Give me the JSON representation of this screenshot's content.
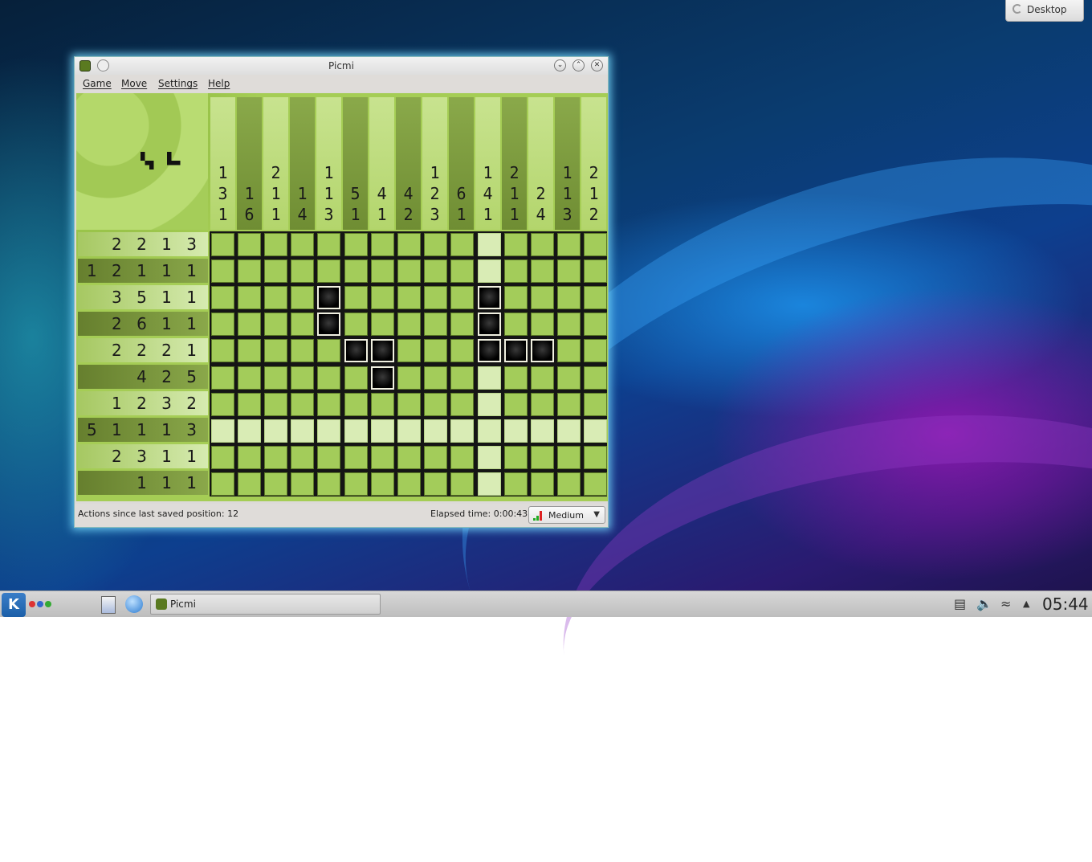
{
  "desktop_tab": {
    "label": "Desktop"
  },
  "window": {
    "title": "Picmi"
  },
  "menu": [
    "Game",
    "Move",
    "Settings",
    "Help"
  ],
  "puzzle": {
    "col_clues": [
      [
        "1",
        "3",
        "1"
      ],
      [
        "1",
        "6"
      ],
      [
        "2",
        "1",
        "1"
      ],
      [
        "1",
        "4"
      ],
      [
        "1",
        "1",
        "3"
      ],
      [
        "5",
        "1"
      ],
      [
        "4",
        "1"
      ],
      [
        "4",
        "2"
      ],
      [
        "1",
        "2",
        "3"
      ],
      [
        "6",
        "1"
      ],
      [
        "1",
        "4",
        "1"
      ],
      [
        "2",
        "1",
        "1"
      ],
      [
        "2",
        "4"
      ],
      [
        "1",
        "1",
        "3"
      ],
      [
        "2",
        "1",
        "2"
      ]
    ],
    "row_clues": [
      "2 2 1 3",
      "1 2 1 1 1 1",
      "3 5 1 1",
      "2 6 1 1",
      "2 2 2 1",
      "4 2 5",
      "1 2 3 2",
      "5 1 1 1 3",
      "2 3 1 1",
      "1 1 1"
    ],
    "filled": [
      [
        2,
        4
      ],
      [
        2,
        10
      ],
      [
        3,
        4
      ],
      [
        3,
        10
      ],
      [
        4,
        5
      ],
      [
        4,
        6
      ],
      [
        4,
        10
      ],
      [
        4,
        11
      ],
      [
        4,
        12
      ],
      [
        5,
        6
      ]
    ],
    "highlight_row": 7,
    "highlight_col": 10
  },
  "status": {
    "actions": "Actions since last saved position: 12",
    "elapsed": "Elapsed time: 0:00:43",
    "difficulty": "Medium"
  },
  "taskbar": {
    "task_label": "Picmi",
    "clock": "05:44"
  },
  "colors": {
    "accent": "#a3cc5a",
    "filled": "#000000"
  }
}
